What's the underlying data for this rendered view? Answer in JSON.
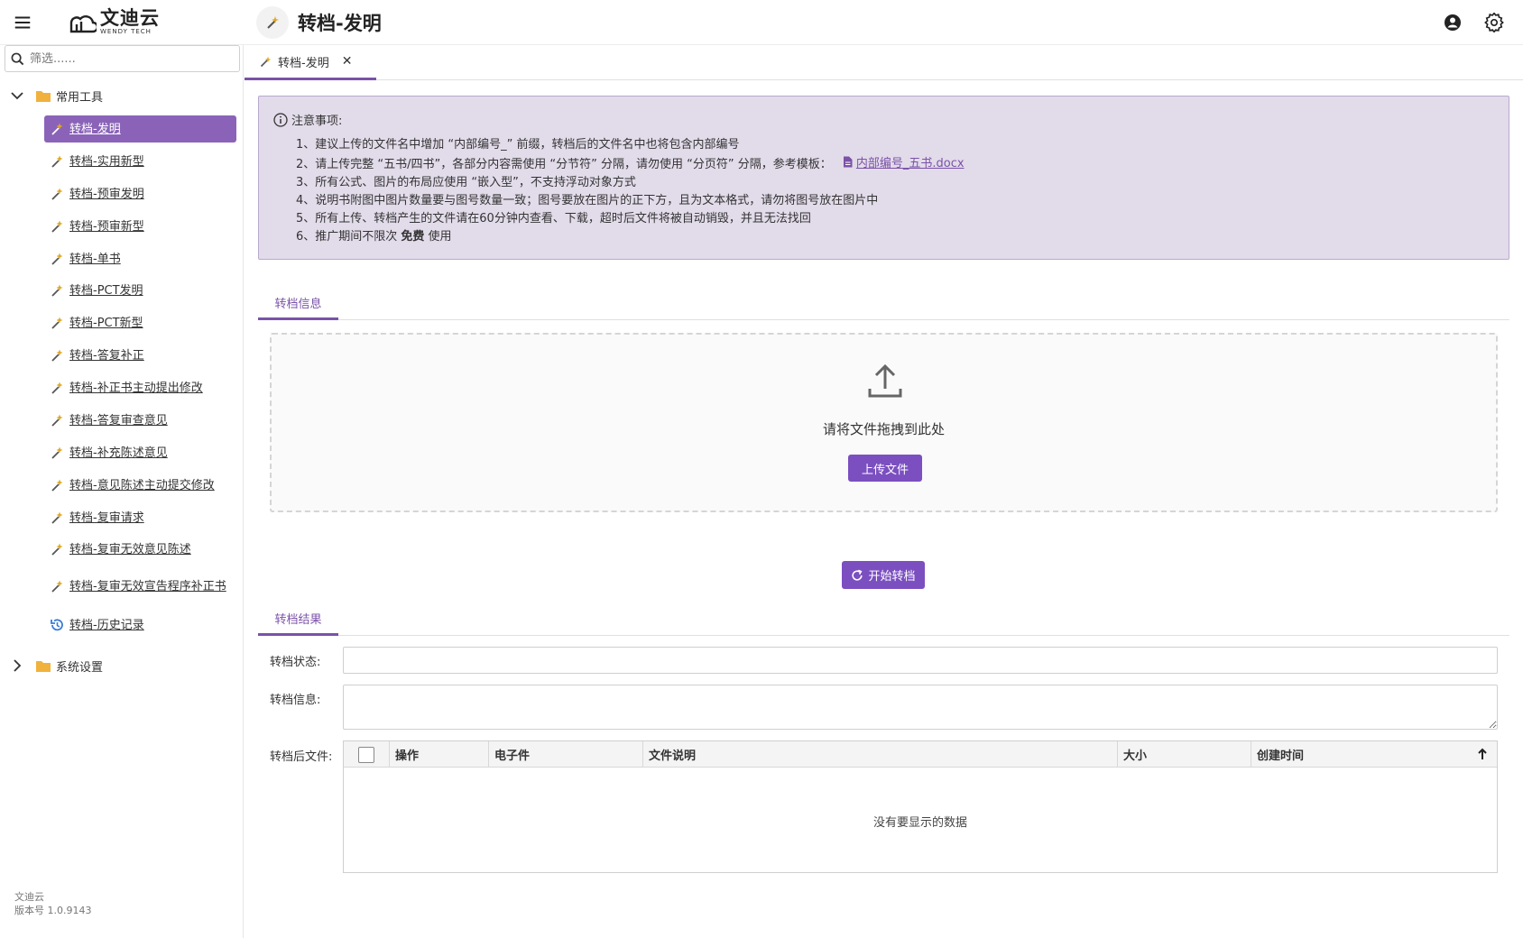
{
  "app": {
    "logo_cn": "文迪云",
    "logo_en": "WENDY TECH",
    "page_title": "转档-发明"
  },
  "sidebar": {
    "filter_placeholder": "筛选......",
    "groups": [
      {
        "label": "常用工具",
        "expanded": true
      },
      {
        "label": "系统设置",
        "expanded": false
      }
    ],
    "items": [
      {
        "label": "转档-发明",
        "active": true
      },
      {
        "label": "转档-实用新型"
      },
      {
        "label": "转档-预审发明"
      },
      {
        "label": "转档-预审新型"
      },
      {
        "label": "转档-单书"
      },
      {
        "label": "转档-PCT发明"
      },
      {
        "label": "转档-PCT新型"
      },
      {
        "label": "转档-答复补正"
      },
      {
        "label": "转档-补正书主动提出修改"
      },
      {
        "label": "转档-答复审查意见"
      },
      {
        "label": "转档-补充陈述意见"
      },
      {
        "label": "转档-意见陈述主动提交修改"
      },
      {
        "label": "转档-复审请求"
      },
      {
        "label": "转档-复审无效意见陈述"
      },
      {
        "label": "转档-复审无效宣告程序补正书"
      },
      {
        "label": "转档-历史记录"
      }
    ],
    "footer_name": "文迪云",
    "footer_version": "版本号 1.0.9143"
  },
  "tabs": [
    {
      "label": "转档-发明",
      "close": "✕"
    }
  ],
  "notice": {
    "title": "注意事项:",
    "lines": [
      "1、建议上传的文件名中增加 “内部编号_” 前缀，转档后的文件名中也将包含内部编号",
      "2、请上传完整 “五书/四书”，各部分内容需使用 “分节符” 分隔，请勿使用 “分页符” 分隔，参考模板：",
      "3、所有公式、图片的布局应使用 “嵌入型”，不支持浮动对象方式",
      "4、说明书附图中图片数量要与图号数量一致；图号要放在图片的正下方，且为文本格式，请勿将图号放在图片中",
      "5、所有上传、转档产生的文件请在60分钟内查看、下载，超时后文件将被自动销毁，并且无法找回"
    ],
    "line6_pre": "6、推广期间不限次 ",
    "line6_bold": "免费",
    "line6_post": " 使用",
    "template_link": "内部编号_五书.docx"
  },
  "info_section": {
    "tab_label": "转档信息",
    "drop_text": "请将文件拖拽到此处",
    "upload_button": "上传文件",
    "start_button": "开始转档"
  },
  "result_section": {
    "tab_label": "转档结果",
    "status_label": "转档状态:",
    "status_value": "",
    "info_label": "转档信息:",
    "info_value": "",
    "files_label": "转档后文件:",
    "columns": [
      "操作",
      "电子件",
      "文件说明",
      "大小",
      "创建时间"
    ],
    "empty_text": "没有要显示的数据"
  },
  "colors": {
    "accent": "#7b4fc0",
    "active_item": "#8a63b8",
    "notice_bg": "#e2dbea",
    "wand_gold": "#e0a820",
    "folder": "#f0b23c"
  }
}
